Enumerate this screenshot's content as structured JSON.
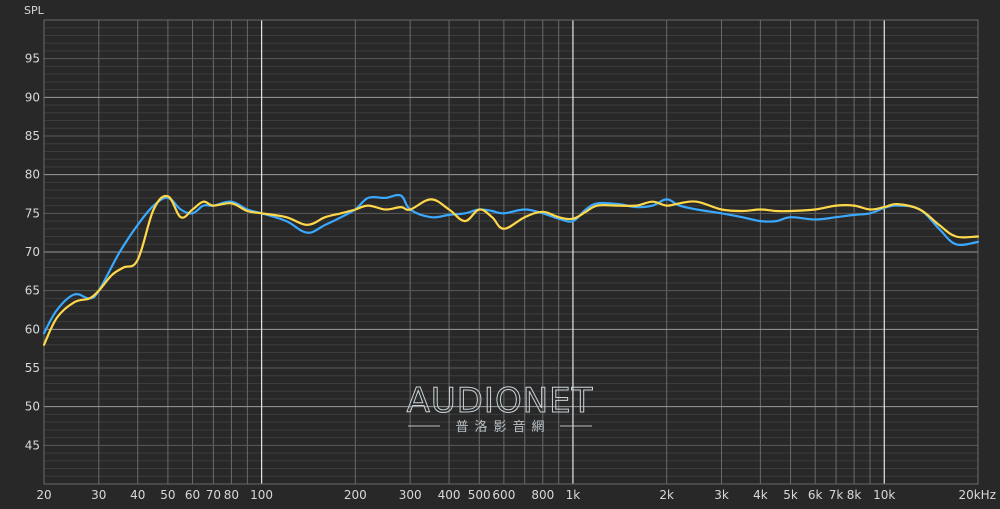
{
  "chart_data": {
    "type": "line",
    "title": "",
    "ylabel": "SPL",
    "xlabel": "",
    "x_scale": "log",
    "xlim": [
      20,
      20000
    ],
    "ylim": [
      40,
      100
    ],
    "grid": true,
    "y_ticks": [
      45,
      50,
      55,
      60,
      65,
      70,
      75,
      80,
      85,
      90,
      95
    ],
    "x_ticks": [
      {
        "v": 20,
        "label": "20"
      },
      {
        "v": 30,
        "label": "30"
      },
      {
        "v": 40,
        "label": "40"
      },
      {
        "v": 50,
        "label": "50"
      },
      {
        "v": 60,
        "label": "60"
      },
      {
        "v": 70,
        "label": "70"
      },
      {
        "v": 80,
        "label": "80"
      },
      {
        "v": 100,
        "label": "100"
      },
      {
        "v": 200,
        "label": "200"
      },
      {
        "v": 300,
        "label": "300"
      },
      {
        "v": 400,
        "label": "400"
      },
      {
        "v": 500,
        "label": "500"
      },
      {
        "v": 600,
        "label": "600"
      },
      {
        "v": 800,
        "label": "800"
      },
      {
        "v": 1000,
        "label": "1k"
      },
      {
        "v": 2000,
        "label": "2k"
      },
      {
        "v": 3000,
        "label": "3k"
      },
      {
        "v": 4000,
        "label": "4k"
      },
      {
        "v": 5000,
        "label": "5k"
      },
      {
        "v": 6000,
        "label": "6k"
      },
      {
        "v": 7000,
        "label": "7k"
      },
      {
        "v": 8000,
        "label": "8k"
      },
      {
        "v": 10000,
        "label": "10k"
      },
      {
        "v": 20000,
        "label": "20kHz"
      }
    ],
    "series": [
      {
        "color": "#3aa9ff",
        "points": [
          [
            20,
            59.5
          ],
          [
            22,
            62.5
          ],
          [
            25,
            64.5
          ],
          [
            28,
            64
          ],
          [
            30,
            65
          ],
          [
            35,
            70
          ],
          [
            40,
            73.5
          ],
          [
            45,
            76
          ],
          [
            50,
            77
          ],
          [
            55,
            75.5
          ],
          [
            60,
            75
          ],
          [
            65,
            76
          ],
          [
            70,
            76
          ],
          [
            80,
            76.5
          ],
          [
            90,
            75.5
          ],
          [
            100,
            75
          ],
          [
            120,
            74
          ],
          [
            140,
            72.5
          ],
          [
            160,
            73.5
          ],
          [
            180,
            74.5
          ],
          [
            200,
            75.5
          ],
          [
            220,
            77
          ],
          [
            250,
            77
          ],
          [
            280,
            77.3
          ],
          [
            300,
            75.5
          ],
          [
            350,
            74.5
          ],
          [
            400,
            74.8
          ],
          [
            450,
            75
          ],
          [
            500,
            75.5
          ],
          [
            550,
            75.3
          ],
          [
            600,
            75
          ],
          [
            700,
            75.5
          ],
          [
            800,
            75
          ],
          [
            900,
            74.3
          ],
          [
            1000,
            74
          ],
          [
            1100,
            75.5
          ],
          [
            1200,
            76.3
          ],
          [
            1400,
            76.2
          ],
          [
            1600,
            75.8
          ],
          [
            1800,
            76
          ],
          [
            2000,
            76.8
          ],
          [
            2200,
            76
          ],
          [
            2500,
            75.5
          ],
          [
            3000,
            75
          ],
          [
            3500,
            74.5
          ],
          [
            4000,
            74
          ],
          [
            4500,
            74
          ],
          [
            5000,
            74.5
          ],
          [
            6000,
            74.2
          ],
          [
            7000,
            74.5
          ],
          [
            8000,
            74.8
          ],
          [
            9000,
            75
          ],
          [
            10000,
            75.7
          ],
          [
            11000,
            76
          ],
          [
            13000,
            75.5
          ],
          [
            15000,
            73
          ],
          [
            17000,
            71
          ],
          [
            20000,
            71.3
          ]
        ]
      },
      {
        "color": "#ffd84a",
        "points": [
          [
            20,
            58
          ],
          [
            22,
            61.5
          ],
          [
            25,
            63.5
          ],
          [
            28,
            64
          ],
          [
            30,
            65
          ],
          [
            33,
            67
          ],
          [
            36,
            68
          ],
          [
            40,
            69
          ],
          [
            45,
            75.5
          ],
          [
            50,
            77.2
          ],
          [
            55,
            74.5
          ],
          [
            60,
            75.5
          ],
          [
            65,
            76.5
          ],
          [
            70,
            76
          ],
          [
            80,
            76.3
          ],
          [
            90,
            75.3
          ],
          [
            100,
            75
          ],
          [
            120,
            74.5
          ],
          [
            140,
            73.5
          ],
          [
            160,
            74.5
          ],
          [
            180,
            75
          ],
          [
            200,
            75.5
          ],
          [
            220,
            76
          ],
          [
            250,
            75.5
          ],
          [
            280,
            75.8
          ],
          [
            300,
            75.5
          ],
          [
            350,
            76.8
          ],
          [
            400,
            75.5
          ],
          [
            450,
            74
          ],
          [
            500,
            75.5
          ],
          [
            550,
            74.5
          ],
          [
            600,
            73
          ],
          [
            700,
            74.5
          ],
          [
            800,
            75.2
          ],
          [
            900,
            74.5
          ],
          [
            1000,
            74.3
          ],
          [
            1100,
            75.2
          ],
          [
            1200,
            76
          ],
          [
            1400,
            76
          ],
          [
            1600,
            76
          ],
          [
            1800,
            76.5
          ],
          [
            2000,
            76
          ],
          [
            2200,
            76.3
          ],
          [
            2500,
            76.5
          ],
          [
            3000,
            75.5
          ],
          [
            3500,
            75.3
          ],
          [
            4000,
            75.5
          ],
          [
            4500,
            75.3
          ],
          [
            5000,
            75.3
          ],
          [
            6000,
            75.5
          ],
          [
            7000,
            76
          ],
          [
            8000,
            76
          ],
          [
            9000,
            75.5
          ],
          [
            10000,
            75.8
          ],
          [
            11000,
            76.2
          ],
          [
            13000,
            75.5
          ],
          [
            15000,
            73.5
          ],
          [
            17000,
            72
          ],
          [
            20000,
            72
          ]
        ]
      }
    ]
  },
  "watermark": {
    "main": "AUDIONET",
    "sub": "普洛影音網"
  }
}
